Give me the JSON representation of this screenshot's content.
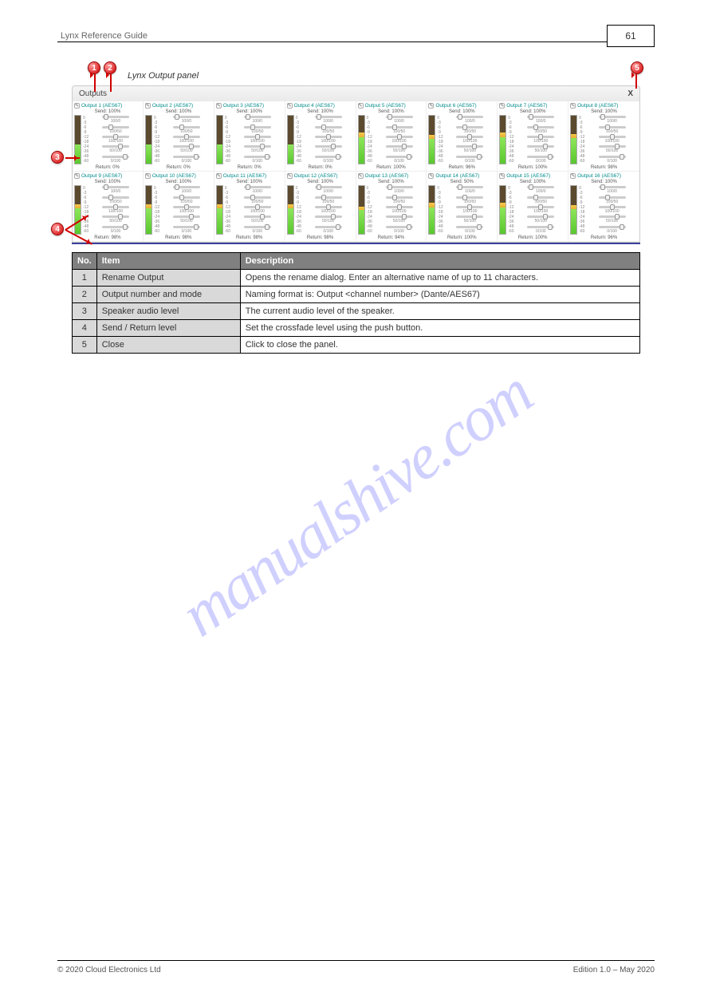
{
  "header": {
    "doc_title": "Lynx Reference Guide",
    "page_box": "61"
  },
  "figure_caption": "Lynx Output panel",
  "panel": {
    "title": "Outputs",
    "close_label": "X",
    "scale_ticks": [
      "0",
      "-3",
      "-6",
      "-9",
      "-12",
      "-18",
      "-24",
      "-36",
      "-48",
      "-60"
    ],
    "slider_labels": [
      "100/0",
      "100/50",
      "100/100",
      "50/100",
      "0/100"
    ],
    "outputs": [
      {
        "n": 1,
        "proto": "AES67",
        "send": "100%",
        "return": "0%",
        "g": 40,
        "y": 0
      },
      {
        "n": 2,
        "proto": "AES67",
        "send": "100%",
        "return": "0%",
        "g": 40,
        "y": 0
      },
      {
        "n": 3,
        "proto": "AES67",
        "send": "100%",
        "return": "0%",
        "g": 40,
        "y": 0
      },
      {
        "n": 4,
        "proto": "AES67",
        "send": "100%",
        "return": "0%",
        "g": 40,
        "y": 0
      },
      {
        "n": 5,
        "proto": "AES67",
        "send": "100%",
        "return": "100%",
        "g": 55,
        "y": 10
      },
      {
        "n": 6,
        "proto": "AES67",
        "send": "100%",
        "return": "96%",
        "g": 52,
        "y": 8
      },
      {
        "n": 7,
        "proto": "AES67",
        "send": "100%",
        "return": "100%",
        "g": 55,
        "y": 10
      },
      {
        "n": 8,
        "proto": "AES67",
        "send": "100%",
        "return": "98%",
        "g": 53,
        "y": 9
      },
      {
        "n": 9,
        "proto": "AES67",
        "send": "100%",
        "return": "98%",
        "g": 53,
        "y": 8
      },
      {
        "n": 10,
        "proto": "AES67",
        "send": "100%",
        "return": "98%",
        "g": 53,
        "y": 8
      },
      {
        "n": 11,
        "proto": "AES67",
        "send": "100%",
        "return": "98%",
        "g": 53,
        "y": 8
      },
      {
        "n": 12,
        "proto": "AES67",
        "send": "100%",
        "return": "98%",
        "g": 53,
        "y": 8
      },
      {
        "n": 13,
        "proto": "AES67",
        "send": "100%",
        "return": "94%",
        "g": 50,
        "y": 6
      },
      {
        "n": 14,
        "proto": "AES67",
        "send": "50%",
        "return": "100%",
        "g": 55,
        "y": 10
      },
      {
        "n": 15,
        "proto": "AES67",
        "send": "100%",
        "return": "100%",
        "g": 55,
        "y": 10
      },
      {
        "n": 16,
        "proto": "AES67",
        "send": "100%",
        "return": "96%",
        "g": 52,
        "y": 8
      }
    ]
  },
  "callouts": {
    "c1": "1",
    "c2": "2",
    "c3": "3",
    "c4": "4",
    "c5": "5"
  },
  "table": {
    "headers": {
      "no": "No.",
      "item": "Item",
      "desc": "Description"
    },
    "rows": [
      {
        "no": "1",
        "item": "Rename Output",
        "desc": "Opens the rename dialog. Enter an alternative name of up to 11 characters."
      },
      {
        "no": "2",
        "item": "Output number and mode",
        "desc": "Naming format is: Output <channel number> (Dante/AES67)"
      },
      {
        "no": "3",
        "item": "Speaker audio level",
        "desc": "The current audio level of the speaker."
      },
      {
        "no": "4",
        "item": "Send / Return level",
        "desc": "Set the crossfade level using the push button."
      },
      {
        "no": "5",
        "item": "Close",
        "desc": "Click to close the panel."
      }
    ]
  },
  "footer": {
    "left": "© 2020 Cloud Electronics Ltd",
    "right": "Edition 1.0 – May 2020"
  },
  "watermark": "manualshive.com"
}
